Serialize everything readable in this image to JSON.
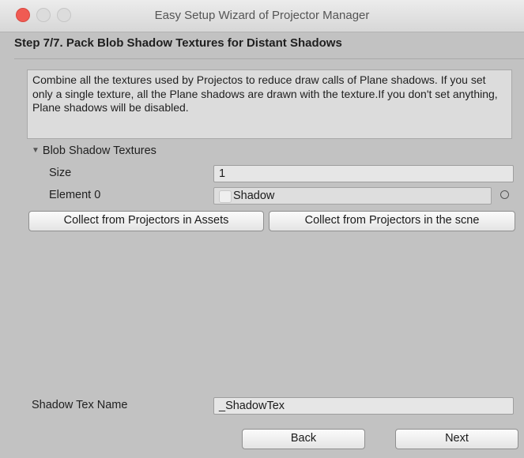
{
  "window": {
    "title": "Easy Setup Wizard of Projector Manager"
  },
  "step_title": "Step 7/7. Pack Blob Shadow Textures for Distant Shadows",
  "help_text": "Combine all the textures used by Projectos to reduce draw calls of Plane shadows. If you set only a single texture, all the Plane shadows are drawn with the texture.If you don't set anything, Plane shadows will be disabled.",
  "foldout": {
    "label": "Blob Shadow Textures",
    "expanded": true
  },
  "size": {
    "label": "Size",
    "value": "1"
  },
  "element0": {
    "label": "Element 0",
    "value": "Shadow",
    "icon": "texture-icon"
  },
  "buttons": {
    "collect_assets": "Collect from Projectors in Assets",
    "collect_scene": "Collect from Projectors in the scne",
    "back": "Back",
    "next": "Next"
  },
  "shadow_tex": {
    "label": "Shadow Tex Name",
    "value": "_ShadowTex"
  },
  "colors": {
    "close": "#f05b53",
    "window_bg": "#c2c2c2",
    "help_bg": "#dcdcdc"
  }
}
